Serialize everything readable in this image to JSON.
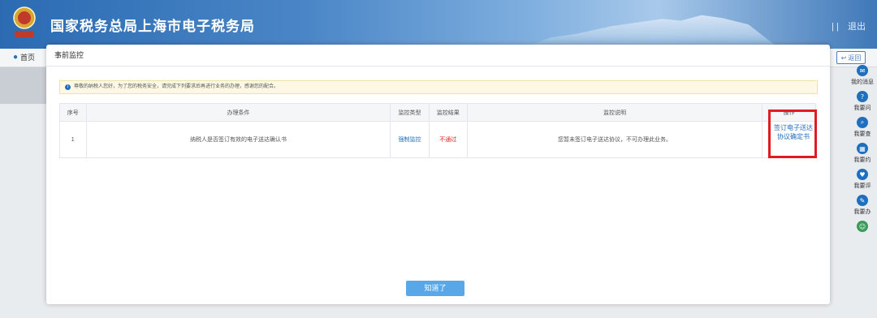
{
  "header": {
    "title": "国家税务总局上海市电子税务局",
    "right_sep": "| |",
    "logout": "退出"
  },
  "nav": {
    "home": "首页",
    "back": "返回"
  },
  "sidebar": {
    "items": [
      {
        "label": "我的消息",
        "icon": "message-icon"
      },
      {
        "label": "我要问",
        "icon": "question-icon"
      },
      {
        "label": "我要查",
        "icon": "search-icon"
      },
      {
        "label": "我要约",
        "icon": "calendar-icon"
      },
      {
        "label": "我要评",
        "icon": "rating-icon"
      },
      {
        "label": "我要办",
        "icon": "edit-icon"
      },
      {
        "label": "",
        "icon": "robot-icon"
      }
    ]
  },
  "modal": {
    "title": "事前监控",
    "notice": "尊敬的纳税人您好，为了您的税务安全，请完成下列要求后再进行业务的办理，感谢您的配合。",
    "table": {
      "headers": [
        "序号",
        "办理条件",
        "监控类型",
        "监控结果",
        "监控说明",
        "操作"
      ],
      "rows": [
        {
          "index": "1",
          "condition": "纳税人是否签订有效的电子送达确认书",
          "type": "强制监控",
          "result": "不通过",
          "description": "您暂未签订电子送达协议，不可办理此业务。",
          "action": "签订电子送达协议确定书"
        }
      ]
    },
    "ok_button": "知道了"
  },
  "colors": {
    "accent": "#1f6fbf",
    "fail": "#e02020",
    "highlight_box": "#e01b24",
    "button": "#5aa7e8"
  }
}
